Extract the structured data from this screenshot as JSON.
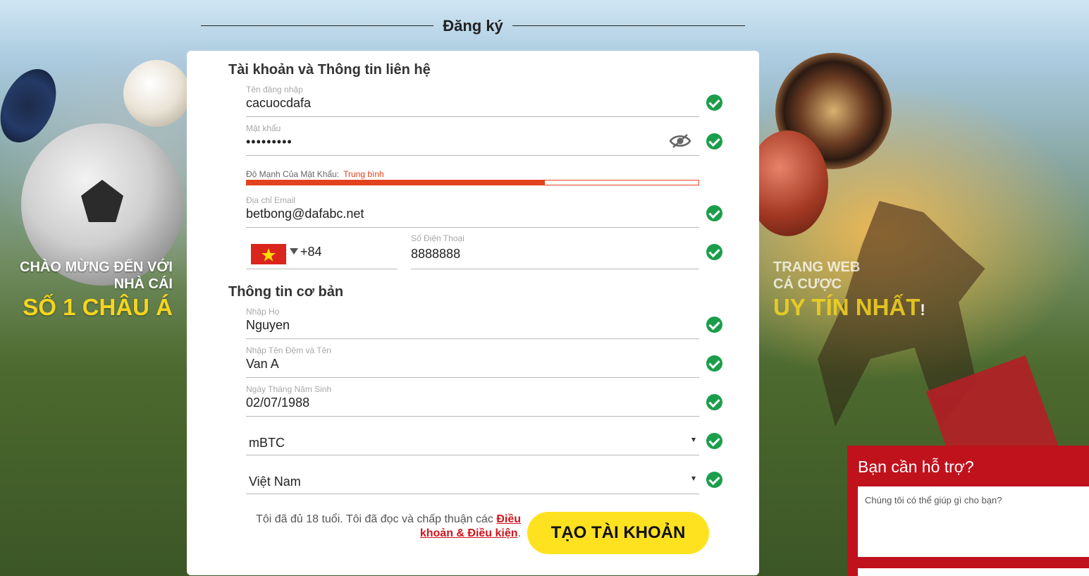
{
  "header": {
    "title": "Đăng ký"
  },
  "promo_left": {
    "line1": "CHÀO MỪNG ĐẾN VỚI",
    "line2": "NHÀ CÁI",
    "highlight": "SỐ 1 CHÂU Á"
  },
  "promo_right": {
    "line1": "TRANG WEB",
    "line2": "CÁ CƯỢC",
    "highlight": "UY TÍN NHẤT",
    "excl": "!"
  },
  "form": {
    "section_account": "Tài khoản và Thông tin liên hệ",
    "username": {
      "label": "Tên đăng nhập",
      "value": "cacuocdafa"
    },
    "password": {
      "label": "Mật khẩu",
      "value": "•••••••••"
    },
    "strength": {
      "label": "Độ Mạnh Của Mật Khẩu:",
      "level": "Trung bình",
      "fraction": 0.66
    },
    "email": {
      "label": "Địa chỉ Email",
      "value": "betbong@dafabc.net"
    },
    "phone": {
      "country_code": "+84",
      "label": "Số Điện Thoại",
      "value": "8888888"
    },
    "section_basic": "Thông tin cơ bản",
    "last_name": {
      "label": "Nhập Họ",
      "value": "Nguyen"
    },
    "first_name": {
      "label": "Nhập Tên Đệm và Tên",
      "value": "Van A"
    },
    "dob": {
      "label": "Ngày Tháng Năm Sinh",
      "value": "02/07/1988"
    },
    "currency": {
      "value": "mBTC"
    },
    "country": {
      "value": "Việt Nam"
    },
    "terms": {
      "text": "Tôi đã đủ 18 tuổi. Tôi đã đọc và chấp thuận các",
      "link": "Điều khoản & Điều kiện",
      "end": "."
    },
    "submit_label": "TẠO TÀI KHOẢN"
  },
  "support": {
    "title": "Bạn cần hỗ trợ?",
    "placeholder": "Chúng tôi có thể giúp gì cho bạn?"
  },
  "colors": {
    "accent": "#ffe21f",
    "success": "#1b9e4b",
    "danger": "#e2421d",
    "support_bg": "#c0121d"
  }
}
